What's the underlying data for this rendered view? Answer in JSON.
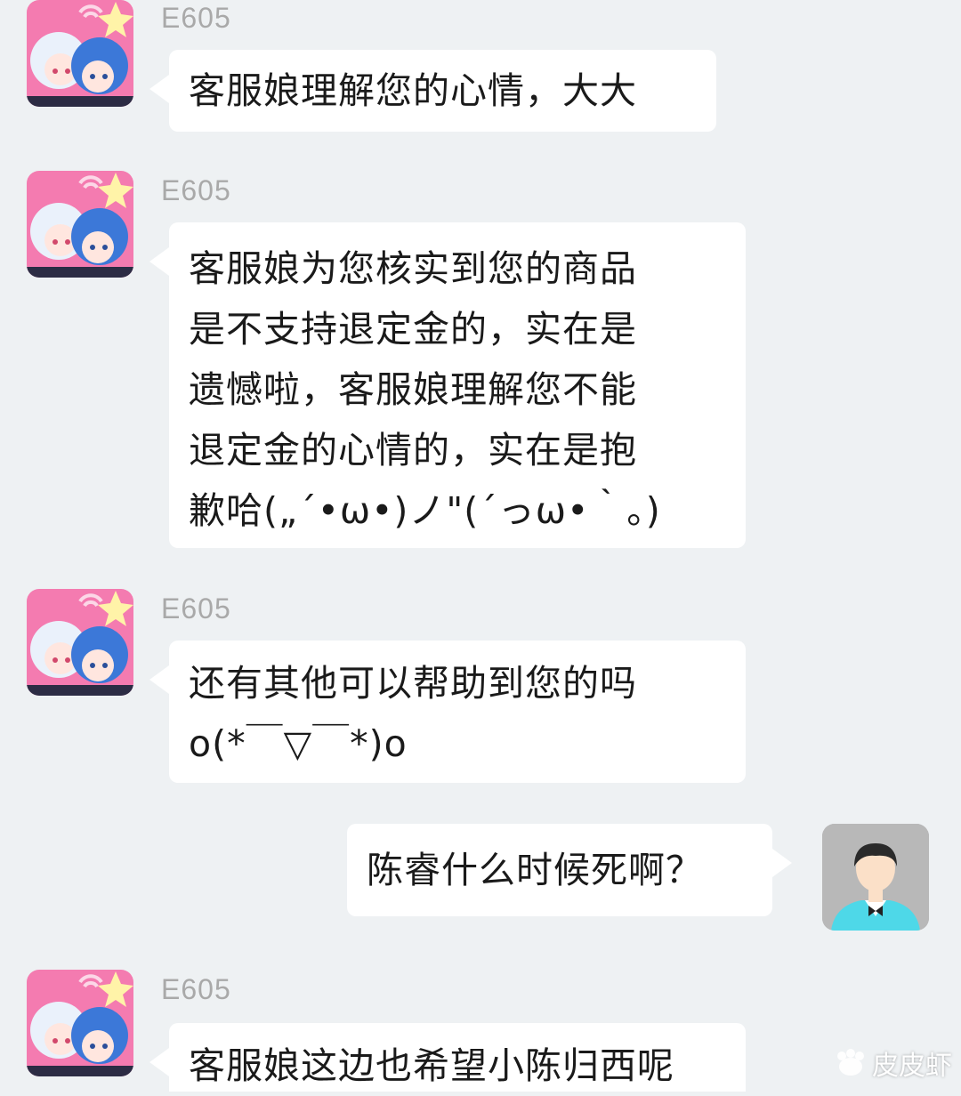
{
  "messages": [
    {
      "sender": "E605",
      "text": "客服娘理解您的心情，大大"
    },
    {
      "sender": "E605",
      "text": "客服娘为您核实到您的商品\n是不支持退定金的，实在是\n遗憾啦，客服娘理解您不能\n退定金的心情的，实在是抱\n歉哈(„´•ω•)ノ\"(´っω•｀。)"
    },
    {
      "sender": "E605",
      "text": "还有其他可以帮助到您的吗\no(*￣▽￣*)o"
    },
    {
      "sender": "",
      "text": "陈睿什么时候死啊？"
    },
    {
      "sender": "E605",
      "text": "客服娘这边也希望小陈归西呢"
    }
  ],
  "watermark": "皮皮虾",
  "colors": {
    "background": "#eef1f3",
    "bubble": "#ffffff",
    "sender_name": "#a9a9a9",
    "avatar_pink": "#f47bb0",
    "user_shirt": "#4ed8e8"
  },
  "icons": {
    "bot_avatar": "anime-avatar-icon",
    "user_avatar": "user-avatar-icon",
    "watermark_logo": "pipixia-logo-icon"
  }
}
